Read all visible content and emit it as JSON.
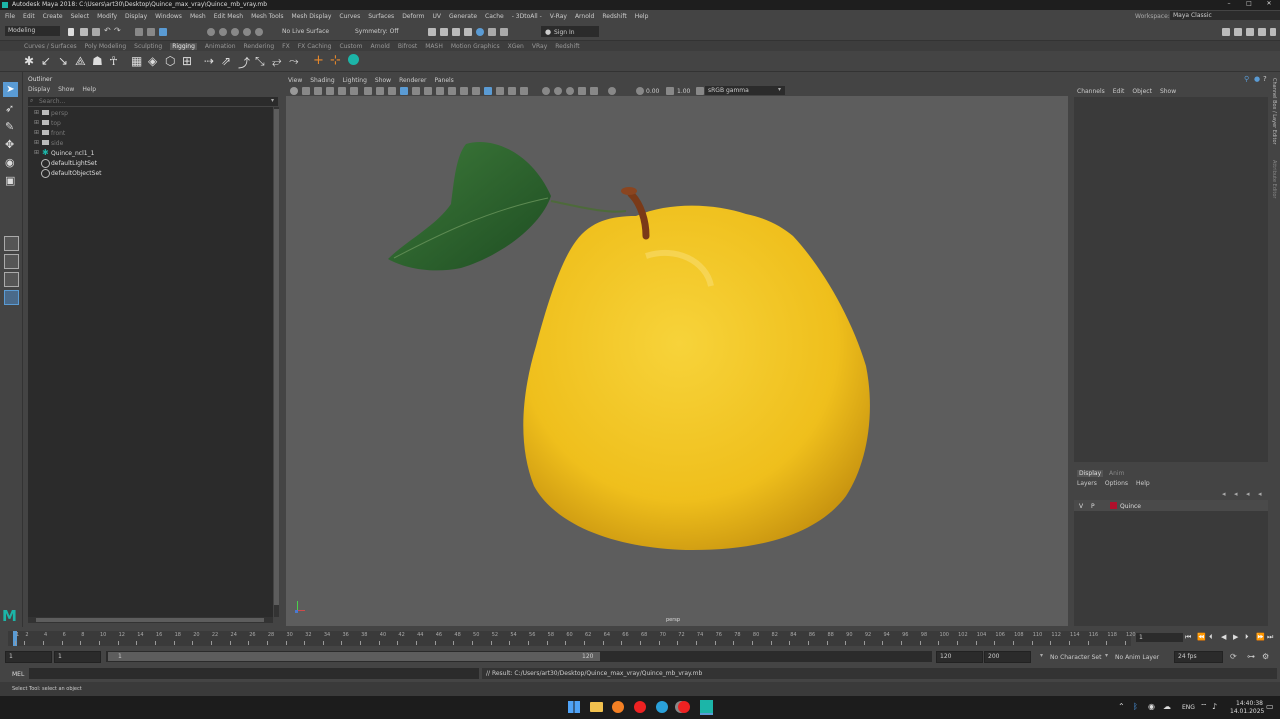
{
  "titlebar": {
    "title": "Autodesk Maya 2018: C:\\Users\\art30\\Desktop\\Quince_max_vray\\Quince_mb_vray.mb"
  },
  "menubar": {
    "items": [
      "File",
      "Edit",
      "Create",
      "Select",
      "Modify",
      "Display",
      "Windows",
      "Mesh",
      "Edit Mesh",
      "Mesh Tools",
      "Mesh Display",
      "Curves",
      "Surfaces",
      "Deform",
      "UV",
      "Generate",
      "Cache",
      "- 3DtoAll -",
      "V-Ray",
      "Arnold",
      "Redshift",
      "Help"
    ],
    "workspace_label": "Workspace:",
    "workspace_value": "Maya Classic"
  },
  "statusline": {
    "mode": "Modeling",
    "live_surface": "No Live Surface",
    "symmetry": "Symmetry: Off",
    "sign_in": "Sign In"
  },
  "shelf": {
    "tabs": [
      "Curves / Surfaces",
      "Poly Modeling",
      "Sculpting",
      "Rigging",
      "Animation",
      "Rendering",
      "FX",
      "FX Caching",
      "Custom",
      "Arnold",
      "Bifrost",
      "MASH",
      "Motion Graphics",
      "XGen",
      "VRay",
      "Redshift"
    ],
    "active": "Rigging"
  },
  "outliner": {
    "title": "Outliner",
    "menu": [
      "Display",
      "Show",
      "Help"
    ],
    "search_placeholder": "Search...",
    "items": [
      "persp",
      "top",
      "front",
      "side",
      "Quince_ncl1_1",
      "defaultLightSet",
      "defaultObjectSet"
    ]
  },
  "viewport": {
    "menu": [
      "View",
      "Shading",
      "Lighting",
      "Show",
      "Renderer",
      "Panels"
    ],
    "exposure": "0.00",
    "gamma": "1.00",
    "colorspace": "sRGB gamma",
    "camera": "persp"
  },
  "channelbox": {
    "menu": [
      "Channels",
      "Edit",
      "Object",
      "Show"
    ],
    "side_tabs": [
      "Channel Box / Layer Editor",
      "Attribute Editor"
    ]
  },
  "layers": {
    "tabs": [
      "Display",
      "Anim"
    ],
    "menu": [
      "Layers",
      "Options",
      "Help"
    ],
    "row": {
      "v": "V",
      "p": "P",
      "name": "Quince",
      "color": "#b0102c"
    }
  },
  "timeline": {
    "ticks": [
      "1",
      "2",
      "4",
      "6",
      "8",
      "10",
      "12",
      "14",
      "16",
      "18",
      "20",
      "22",
      "24",
      "26",
      "28",
      "30",
      "32",
      "34",
      "36",
      "38",
      "40",
      "42",
      "44",
      "46",
      "48",
      "50",
      "52",
      "54",
      "56",
      "58",
      "60",
      "62",
      "64",
      "66",
      "68",
      "70",
      "72",
      "74",
      "76",
      "78",
      "80",
      "82",
      "84",
      "86",
      "88",
      "90",
      "92",
      "94",
      "96",
      "98",
      "100",
      "102",
      "104",
      "106",
      "108",
      "110",
      "112",
      "114",
      "116",
      "118",
      "120"
    ],
    "current_frame": "1"
  },
  "range": {
    "start": "1",
    "anim_start": "1",
    "slider_start": "1",
    "slider_end": "120",
    "anim_end": "120",
    "end": "200",
    "character_set": "No Character Set",
    "anim_layer": "No Anim Layer",
    "fps": "24 fps"
  },
  "commandline": {
    "mel": "MEL",
    "result": "// Result: C:/Users/art30/Desktop/Quince_max_vray/Quince_mb_vray.mb"
  },
  "helpline": {
    "text": "Select Tool: select an object"
  },
  "taskbar": {
    "lang": "ENG",
    "time": "14:40:38",
    "date": "14.01.2025"
  },
  "colors": {
    "accent": "#5a9bd4",
    "viewport_bg": "#5d5d5d",
    "quince": "#f0c21c",
    "leaf": "#2f6b2c",
    "maya_logo": "#1cb5a8"
  }
}
